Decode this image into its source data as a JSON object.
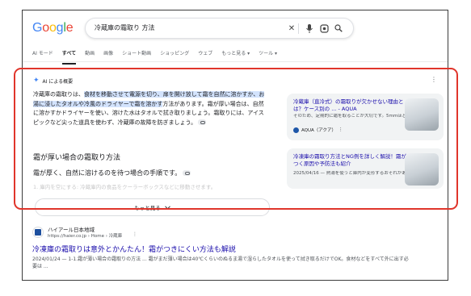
{
  "logo": {
    "letters": [
      "G",
      "o",
      "o",
      "g",
      "l",
      "e"
    ],
    "colors": [
      "#4285f4",
      "#ea4335",
      "#fbbc05",
      "#4285f4",
      "#34a853",
      "#ea4335"
    ]
  },
  "search": {
    "query": "冷蔵庫の霜取り 方法"
  },
  "tabs": [
    {
      "label": "AI モード",
      "active": false
    },
    {
      "label": "すべて",
      "active": true
    },
    {
      "label": "動画",
      "active": false
    },
    {
      "label": "画像",
      "active": false
    },
    {
      "label": "ショート動画",
      "active": false
    },
    {
      "label": "ショッピング",
      "active": false
    },
    {
      "label": "ウェブ",
      "active": false
    },
    {
      "label": "もっと見る ▾",
      "active": false
    },
    {
      "label": "ツール ▾",
      "active": false
    }
  ],
  "ai_overview": {
    "title": "AI による概要",
    "para_intro": "冷蔵庫の霜取りは、",
    "para_highlight": "食材を移動させて電源を切り、扉を開け放して霜を自然に溶かすか、お湯に浸したタオルや冷風のドライヤーで霜を溶かす",
    "para_rest": "方法があります。霜が厚い場合は、自然に溶かすかドライヤーを使い、溶けた水はタオルで拭き取りましょう。霜取りには、アイスピックなど尖った道具を使わず、冷蔵庫の故障を防ぎましょう。",
    "heading": "霜が厚い場合の霜取り方法",
    "subheading": "霜が厚く、自然に溶けるのを待つ場合の手順です。",
    "faded_line": "1. 庫内を空にする: 冷蔵庫内の食品をクーラーボックスなどに移動させます。",
    "more_label": "もっと見る"
  },
  "sources": [
    {
      "title": "冷蔵庫（直冷式）の霜取りが欠かせない理由とは？ケース別の ... - AQUA",
      "snippet": "そのため、定期的に霜を取ることが大切です。5mmほどの薄い霜は、40度程度のぬるま...",
      "site": "AQUA（アクア）"
    },
    {
      "title": "冷凍庫の霜取り方法とNG例を詳しく解説！霜がつく原因や予防法も紹介",
      "snippet": "2025/04/16 — 熱湯を使うと庫内が変形するおそれがあるので避けましょう ...",
      "site": ""
    }
  ],
  "result": {
    "site": "ハイアール日本地域",
    "url": "https://haier.co.jp › Home › 冷蔵庫",
    "title": "冷凍庫の霜取りは意外とかんたん！霜がつきにくい方法も解説",
    "snippet": "2024/01/24 — 1-1.霜が薄い場合の霜取りの方法 ... 霜がまだ薄い場合は40℃くらいのぬるま湯で湿らしたタオルを使って拭き取るだけでOK。食材などをすべて外に出す必要は ..."
  }
}
